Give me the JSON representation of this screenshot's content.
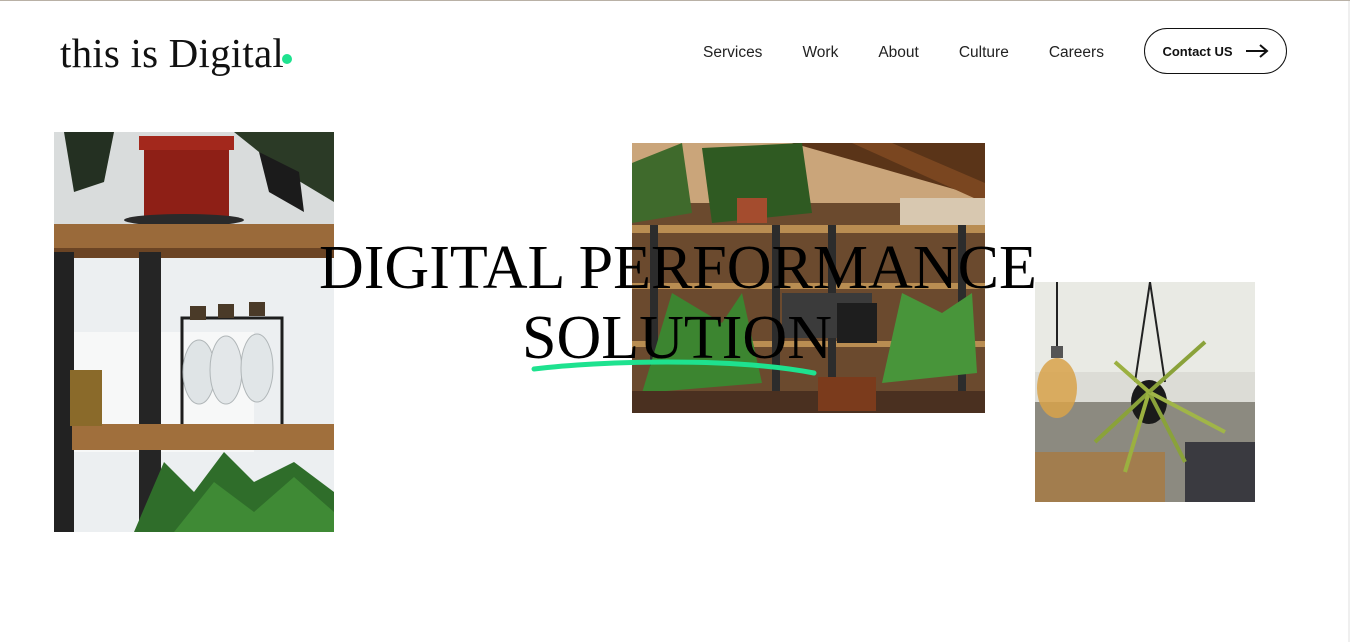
{
  "header": {
    "logo_text": "this is Digital",
    "accent_color": "#1ee28f",
    "nav": [
      "Services",
      "Work",
      "About",
      "Culture",
      "Careers"
    ],
    "contact_label": "Contact US",
    "contact_icon": "arrow-right-icon"
  },
  "hero": {
    "line1": "DIGITAL PERFORMANCE",
    "line2": "SOLUTION"
  },
  "images": [
    {
      "name": "shelf-plants-photo"
    },
    {
      "name": "office-plants-photo"
    },
    {
      "name": "hanging-plant-photo"
    }
  ]
}
